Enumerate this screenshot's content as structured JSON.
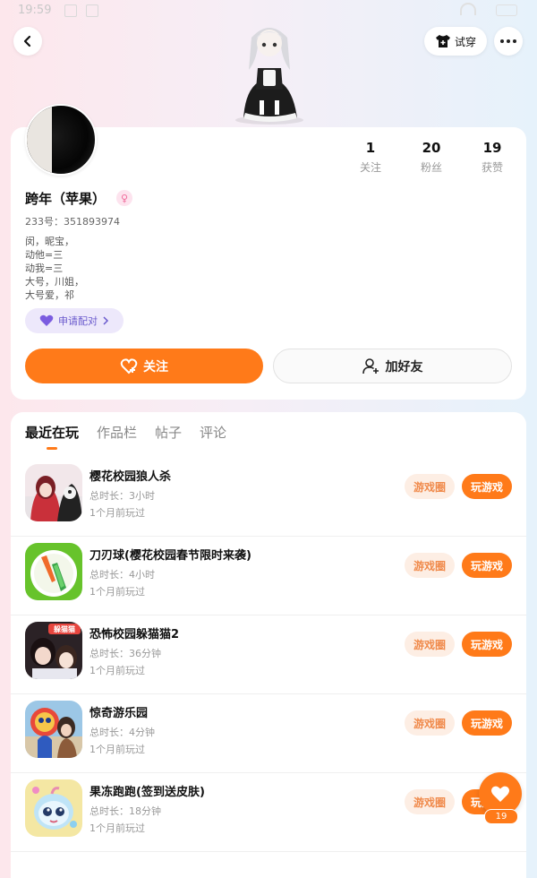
{
  "status_bar": {
    "time": "19:59"
  },
  "header": {
    "back_icon": "chevron-left-icon",
    "tryon_label": "试穿",
    "more_icon": "more-dots-icon"
  },
  "profile": {
    "username": "跨年（苹果）",
    "gender_icon": "female-icon",
    "uid": "233号：351893974",
    "bio_lines": [
      "闵，昵宝，",
      "动他=三",
      "动我=三",
      "大号，川姐，",
      "大号爱，祁"
    ],
    "stats": [
      {
        "value": "1",
        "label": "关注"
      },
      {
        "value": "20",
        "label": "粉丝"
      },
      {
        "value": "19",
        "label": "获赞"
      }
    ],
    "pair_label": "申请配对",
    "follow_label": "关注",
    "add_friend_label": "加好友"
  },
  "tabs": [
    "最近在玩",
    "作品栏",
    "帖子",
    "评论"
  ],
  "games": [
    {
      "title": "樱花校园狼人杀",
      "duration": "总时长：3小时",
      "last_played": "1个月前玩过",
      "circle_label": "游戏圈",
      "play_label": "玩游戏"
    },
    {
      "title": "刀刃球(樱花校园春节限时来袭)",
      "duration": "总时长：4小时",
      "last_played": "1个月前玩过",
      "circle_label": "游戏圈",
      "play_label": "玩游戏"
    },
    {
      "title": "恐怖校园躲猫猫2",
      "duration": "总时长：36分钟",
      "last_played": "1个月前玩过",
      "circle_label": "游戏圈",
      "play_label": "玩游戏"
    },
    {
      "title": "惊奇游乐园",
      "duration": "总时长：4分钟",
      "last_played": "1个月前玩过",
      "circle_label": "游戏圈",
      "play_label": "玩游戏"
    },
    {
      "title": "果冻跑跑(签到送皮肤)",
      "duration": "总时长：18分钟",
      "last_played": "1个月前玩过",
      "circle_label": "游戏圈",
      "play_label": "玩游戏"
    }
  ],
  "game3_icon_text": "躲猫猫",
  "fab": {
    "icon": "heart-icon",
    "count": "19"
  },
  "colors": {
    "accent": "#ff7a19",
    "accent_soft": "#fdeee4",
    "pair_bg": "#ede8fb",
    "pair_text": "#6a5acd"
  }
}
